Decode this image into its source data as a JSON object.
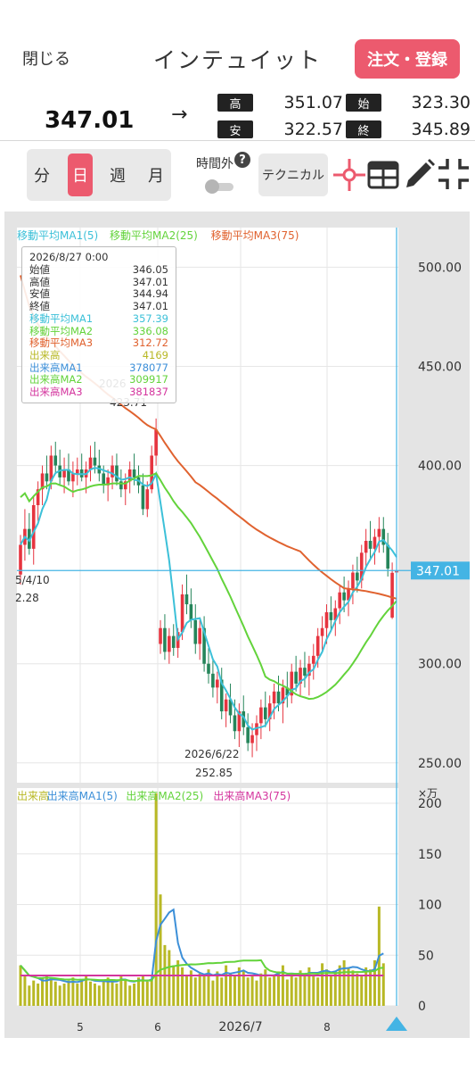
{
  "header": {
    "close_label": "閉じる",
    "title": "インテュイット",
    "order_label": "注文・登録"
  },
  "quote": {
    "price": "347.01",
    "arrow": "→",
    "high_label": "高",
    "high": "351.07",
    "open_label": "始",
    "open": "323.30",
    "low_label": "安",
    "low": "322.57",
    "close_label": "終",
    "close": "345.89"
  },
  "toolbar": {
    "periods": [
      "分",
      "日",
      "週",
      "月"
    ],
    "active_period": "日",
    "after_hours_label": "時間外",
    "after_hours_help": "?",
    "after_hours_on": false,
    "technical_label": "テクニカル",
    "icons": [
      "crosshair-icon",
      "table-icon",
      "pen-icon",
      "fit-screen-icon"
    ]
  },
  "legend_price": [
    "移動平均MA1(5)",
    "移動平均MA2(25)",
    "移動平均MA3(75)"
  ],
  "legend_volume": [
    "出来高",
    "出来高MA1(5)",
    "出来高MA2(25)",
    "出来高MA3(75)"
  ],
  "colors": {
    "accent": "#ec5a6e",
    "ma1": "#3cc0d8",
    "ma2": "#63d33b",
    "ma3": "#e0622f",
    "volume": "#b8b825",
    "vma3": "#d4359e",
    "up": "#e6343f",
    "down": "#25855a",
    "cursor": "#44b4e4"
  },
  "tooltip": {
    "date": "2026/8/27 0:00",
    "rows": [
      {
        "k": "始値",
        "v": "346.05",
        "color": "#333333"
      },
      {
        "k": "高値",
        "v": "347.01",
        "color": "#333333"
      },
      {
        "k": "安値",
        "v": "344.94",
        "color": "#333333"
      },
      {
        "k": "終値",
        "v": "347.01",
        "color": "#333333"
      },
      {
        "k": "移動平均MA1",
        "v": "357.39",
        "color": "#3cc0d8"
      },
      {
        "k": "移動平均MA2",
        "v": "336.08",
        "color": "#63d33b"
      },
      {
        "k": "移動平均MA3",
        "v": "312.72",
        "color": "#e0622f"
      },
      {
        "k": "出来高",
        "v": "4169",
        "color": "#b8b825"
      },
      {
        "k": "出来高MA1",
        "v": "378077",
        "color": "#3c8fd8"
      },
      {
        "k": "出来高MA2",
        "v": "309917",
        "color": "#63d33b"
      },
      {
        "k": "出来高MA3",
        "v": "381837",
        "color": "#d4359e"
      }
    ]
  },
  "annotations": {
    "peak_date": "2026",
    "peak_value": "423.71",
    "left_date": "5/4/10",
    "left_value": "2.28",
    "low_date": "2026/6/22",
    "low_value": "252.85",
    "current_price_tag": "347.01"
  },
  "chart_data": {
    "type": "candlestick",
    "price_axis": {
      "ticks": [
        "500.00",
        "450.00",
        "400.00",
        "300.00",
        "250.00"
      ],
      "range": [
        240,
        520
      ]
    },
    "volume_axis": {
      "unit": "×万",
      "ticks": [
        "200",
        "150",
        "100",
        "50",
        "0"
      ],
      "range": [
        0,
        215
      ]
    },
    "x_ticks": [
      "5",
      "6",
      "2026/7",
      "8"
    ],
    "current_price": 347.01,
    "candles": [
      [
        4.0,
        345,
        365,
        340,
        360
      ],
      [
        4.0,
        360,
        378,
        352,
        368
      ],
      [
        4.1,
        368,
        376,
        355,
        358
      ],
      [
        4.1,
        358,
        385,
        350,
        380
      ],
      [
        4.2,
        380,
        392,
        372,
        388
      ],
      [
        4.2,
        388,
        400,
        380,
        396
      ],
      [
        4.3,
        396,
        405,
        388,
        392
      ],
      [
        4.3,
        392,
        410,
        388,
        405
      ],
      [
        4.4,
        405,
        412,
        396,
        400
      ],
      [
        4.4,
        400,
        408,
        390,
        394
      ],
      [
        4.5,
        394,
        404,
        386,
        398
      ],
      [
        4.5,
        398,
        406,
        390,
        392
      ],
      [
        4.6,
        392,
        402,
        384,
        396
      ],
      [
        4.6,
        396,
        404,
        390,
        398
      ],
      [
        4.7,
        398,
        406,
        392,
        394
      ],
      [
        4.7,
        394,
        402,
        386,
        398
      ],
      [
        4.8,
        398,
        410,
        392,
        404
      ],
      [
        4.8,
        404,
        412,
        396,
        400
      ],
      [
        4.9,
        400,
        408,
        392,
        396
      ],
      [
        4.9,
        396,
        400,
        386,
        390
      ],
      [
        5.0,
        390,
        398,
        382,
        394
      ],
      [
        5.0,
        394,
        405,
        388,
        400
      ],
      [
        5.1,
        400,
        406,
        390,
        392
      ],
      [
        5.1,
        392,
        398,
        384,
        388
      ],
      [
        5.2,
        388,
        396,
        380,
        392
      ],
      [
        5.2,
        392,
        402,
        386,
        398
      ],
      [
        5.3,
        398,
        406,
        390,
        394
      ],
      [
        5.3,
        394,
        400,
        386,
        390
      ],
      [
        5.4,
        390,
        396,
        375,
        378
      ],
      [
        5.4,
        378,
        392,
        374,
        388
      ],
      [
        5.5,
        388,
        410,
        386,
        405
      ],
      [
        5.5,
        405,
        423.7,
        400,
        418
      ],
      [
        5.6,
        310,
        322,
        305,
        318
      ],
      [
        5.6,
        318,
        325,
        302,
        306
      ],
      [
        5.7,
        306,
        318,
        300,
        314
      ],
      [
        5.7,
        314,
        320,
        304,
        308
      ],
      [
        5.8,
        308,
        318,
        303,
        316
      ],
      [
        5.8,
        316,
        340,
        312,
        335
      ],
      [
        5.9,
        335,
        345,
        325,
        330
      ],
      [
        5.9,
        330,
        338,
        318,
        322
      ],
      [
        6.0,
        322,
        330,
        305,
        310
      ],
      [
        6.0,
        310,
        322,
        302,
        318
      ],
      [
        6.1,
        318,
        324,
        296,
        300
      ],
      [
        6.1,
        300,
        308,
        290,
        295
      ],
      [
        6.2,
        295,
        302,
        283,
        288
      ],
      [
        6.2,
        288,
        296,
        280,
        292
      ],
      [
        6.3,
        292,
        298,
        272,
        276
      ],
      [
        6.3,
        276,
        285,
        268,
        282
      ],
      [
        6.4,
        282,
        290,
        270,
        274
      ],
      [
        6.4,
        274,
        282,
        262,
        266
      ],
      [
        6.5,
        266,
        280,
        258,
        276
      ],
      [
        6.5,
        276,
        284,
        264,
        268
      ],
      [
        6.6,
        268,
        275,
        256,
        260
      ],
      [
        6.6,
        260,
        270,
        252.85,
        264
      ],
      [
        6.7,
        264,
        274,
        256,
        270
      ],
      [
        6.7,
        270,
        282,
        262,
        278
      ],
      [
        6.8,
        278,
        286,
        268,
        272
      ],
      [
        6.8,
        272,
        284,
        266,
        280
      ],
      [
        6.9,
        280,
        290,
        272,
        286
      ],
      [
        6.9,
        286,
        294,
        276,
        280
      ],
      [
        7.0,
        280,
        292,
        270,
        288
      ],
      [
        7.0,
        288,
        296,
        278,
        284
      ],
      [
        7.1,
        284,
        300,
        280,
        296
      ],
      [
        7.1,
        296,
        304,
        286,
        290
      ],
      [
        7.2,
        290,
        302,
        284,
        298
      ],
      [
        7.2,
        298,
        306,
        288,
        294
      ],
      [
        7.3,
        294,
        304,
        284,
        300
      ],
      [
        7.3,
        300,
        310,
        292,
        304
      ],
      [
        7.4,
        304,
        318,
        298,
        314
      ],
      [
        7.4,
        314,
        324,
        306,
        318
      ],
      [
        7.5,
        318,
        330,
        310,
        326
      ],
      [
        7.5,
        326,
        334,
        316,
        322
      ],
      [
        7.6,
        322,
        332,
        314,
        328
      ],
      [
        7.6,
        328,
        340,
        320,
        336
      ],
      [
        7.7,
        336,
        344,
        326,
        332
      ],
      [
        7.7,
        332,
        342,
        324,
        338
      ],
      [
        7.8,
        338,
        350,
        330,
        346
      ],
      [
        7.8,
        346,
        354,
        336,
        342
      ],
      [
        7.9,
        342,
        360,
        338,
        356
      ],
      [
        7.9,
        356,
        368,
        348,
        362
      ],
      [
        8.0,
        362,
        372,
        352,
        358
      ],
      [
        8.0,
        358,
        368,
        350,
        364
      ],
      [
        8.1,
        364,
        374,
        356,
        368
      ],
      [
        8.1,
        368,
        374,
        356,
        360
      ],
      [
        8.2,
        360,
        366,
        344,
        348
      ],
      [
        8.2,
        323.3,
        351.07,
        322.57,
        345.89
      ],
      [
        8.3,
        346.05,
        347.01,
        344.94,
        347.01
      ]
    ],
    "volume_bars": [
      40,
      30,
      20,
      25,
      22,
      28,
      30,
      26,
      24,
      20,
      22,
      25,
      28,
      22,
      26,
      30,
      24,
      22,
      20,
      26,
      28,
      24,
      22,
      30,
      26,
      20,
      22,
      28,
      30,
      24,
      26,
      210,
      110,
      60,
      55,
      40,
      45,
      38,
      30,
      35,
      28,
      32,
      30,
      36,
      25,
      34,
      28,
      40,
      32,
      30,
      38,
      35,
      28,
      30,
      25,
      32,
      36,
      28,
      30,
      34,
      40,
      26,
      30,
      28,
      35,
      32,
      38,
      30,
      28,
      42,
      36,
      30,
      34,
      40,
      45,
      38,
      35,
      32,
      30,
      38,
      36,
      45,
      98,
      42
    ],
    "volume_ma": {
      "ma1": 40,
      "ma2": 32,
      "ma3": 30
    }
  }
}
